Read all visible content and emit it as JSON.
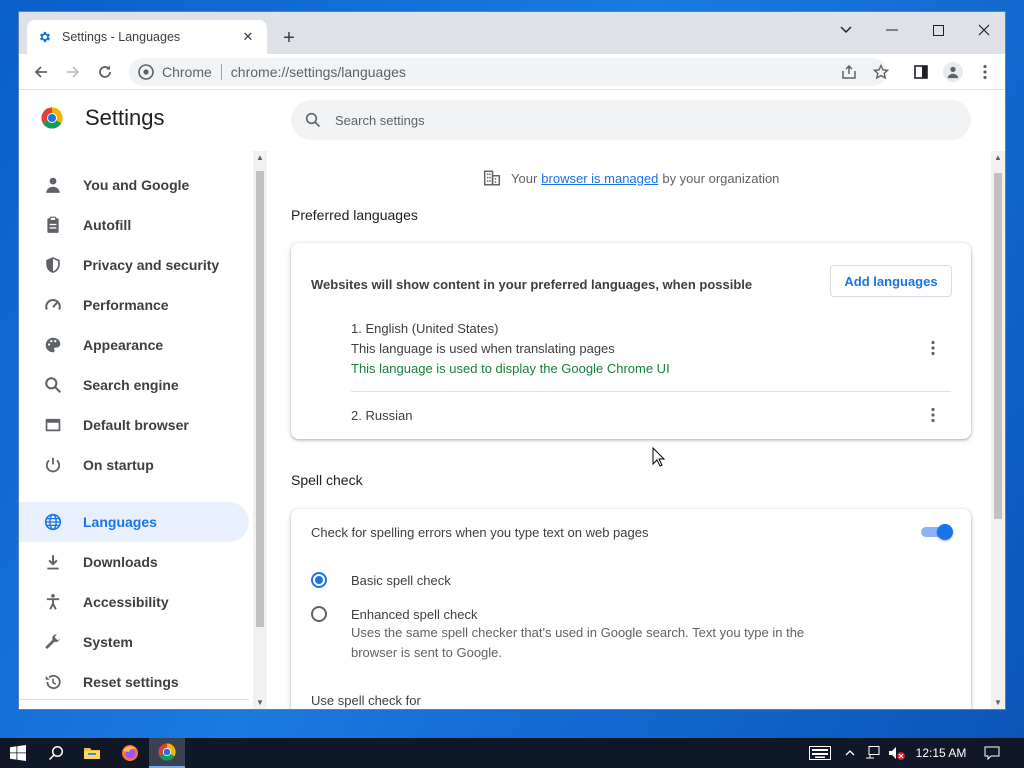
{
  "browser": {
    "tab_title": "Settings - Languages",
    "omnibox_site": "Chrome",
    "omnibox_url": "chrome://settings/languages"
  },
  "settings": {
    "title": "Settings",
    "search_placeholder": "Search settings",
    "nav": [
      {
        "label": "You and Google",
        "icon": "person-icon"
      },
      {
        "label": "Autofill",
        "icon": "clipboard-icon"
      },
      {
        "label": "Privacy and security",
        "icon": "shield-icon"
      },
      {
        "label": "Performance",
        "icon": "speedometer-icon"
      },
      {
        "label": "Appearance",
        "icon": "palette-icon"
      },
      {
        "label": "Search engine",
        "icon": "search-icon"
      },
      {
        "label": "Default browser",
        "icon": "browser-icon"
      },
      {
        "label": "On startup",
        "icon": "power-icon"
      },
      {
        "label": "Languages",
        "icon": "globe-icon",
        "active": true
      },
      {
        "label": "Downloads",
        "icon": "download-icon"
      },
      {
        "label": "Accessibility",
        "icon": "accessibility-icon"
      },
      {
        "label": "System",
        "icon": "wrench-icon"
      },
      {
        "label": "Reset settings",
        "icon": "history-icon"
      }
    ],
    "managed": {
      "prefix": "Your",
      "link": "browser is managed",
      "suffix": "by your organization"
    },
    "preferred": {
      "heading": "Preferred languages",
      "description": "Websites will show content in your preferred languages, when possible",
      "add_button": "Add languages",
      "languages": [
        {
          "name": "1. English (United States)",
          "note": "This language is used when translating pages",
          "ui_note": "This language is used to display the Google Chrome UI"
        },
        {
          "name": "2. Russian"
        }
      ]
    },
    "spell": {
      "heading": "Spell check",
      "toggle_label": "Check for spelling errors when you type text on web pages",
      "toggle_on": true,
      "basic_label": "Basic spell check",
      "enhanced_label": "Enhanced spell check",
      "enhanced_desc": "Uses the same spell checker that's used in Google search. Text you type in the browser is sent to Google.",
      "use_for": "Use spell check for"
    }
  },
  "taskbar": {
    "time": "12:15 AM"
  },
  "colors": {
    "accent": "#1a73e8",
    "green": "#188038",
    "active_nav_bg": "#e8f0fe"
  }
}
